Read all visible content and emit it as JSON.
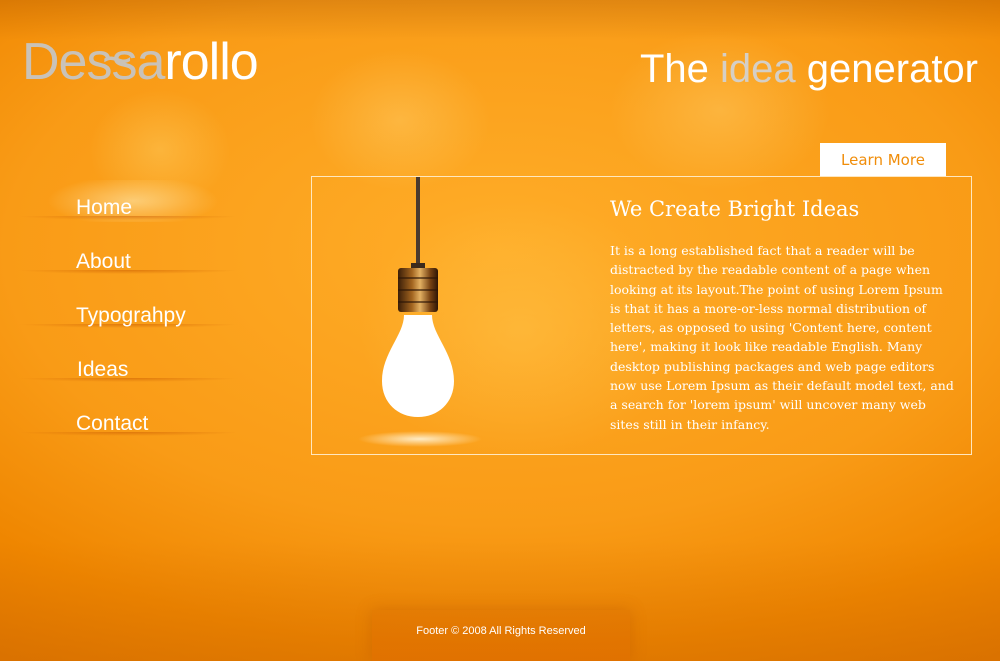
{
  "header": {
    "logo": {
      "part1": "De",
      "part2": "ss",
      "part3": "a",
      "part4": "rollo",
      "tilde": "~"
    },
    "tagline": {
      "before": "The ",
      "accent": "idea",
      "after": " generator"
    }
  },
  "nav": {
    "items": [
      {
        "label": "Home",
        "active": true
      },
      {
        "label": "About"
      },
      {
        "label": "Typograhpy"
      },
      {
        "label": "Ideas"
      },
      {
        "label": "Contact"
      }
    ]
  },
  "content": {
    "learn_more": "Learn More",
    "title": "We Create Bright Ideas",
    "body": "It is a long established fact that a reader will be distracted by the readable content of a page when looking at its layout.The point of using Lorem Ipsum is that it has a more-or-less normal distribution of letters, as opposed to using 'Content here, content here', making it look like readable English. Many desktop publishing packages and web page editors now use Lorem Ipsum as their default model text, and a search for 'lorem ipsum' will uncover many web sites still in their infancy."
  },
  "footer": {
    "text": "Footer © 2008 All Rights Reserved"
  },
  "colors": {
    "background": "#f99b16",
    "accent_text": "#d5cfc6",
    "button_text": "#f08d0a"
  },
  "icons": {
    "illustration": "light-bulb-icon"
  }
}
